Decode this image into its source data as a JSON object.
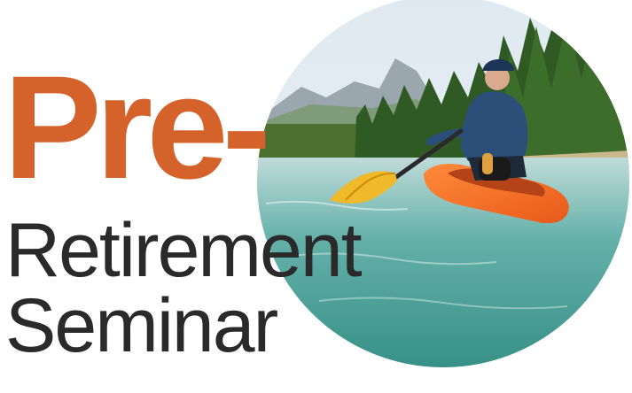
{
  "title": {
    "line1": "Pre-",
    "line2": "Retirement",
    "line3": "Seminar"
  },
  "colors": {
    "accent": "#d4622a",
    "text": "#2a2a2a",
    "background": "#ffffff"
  }
}
